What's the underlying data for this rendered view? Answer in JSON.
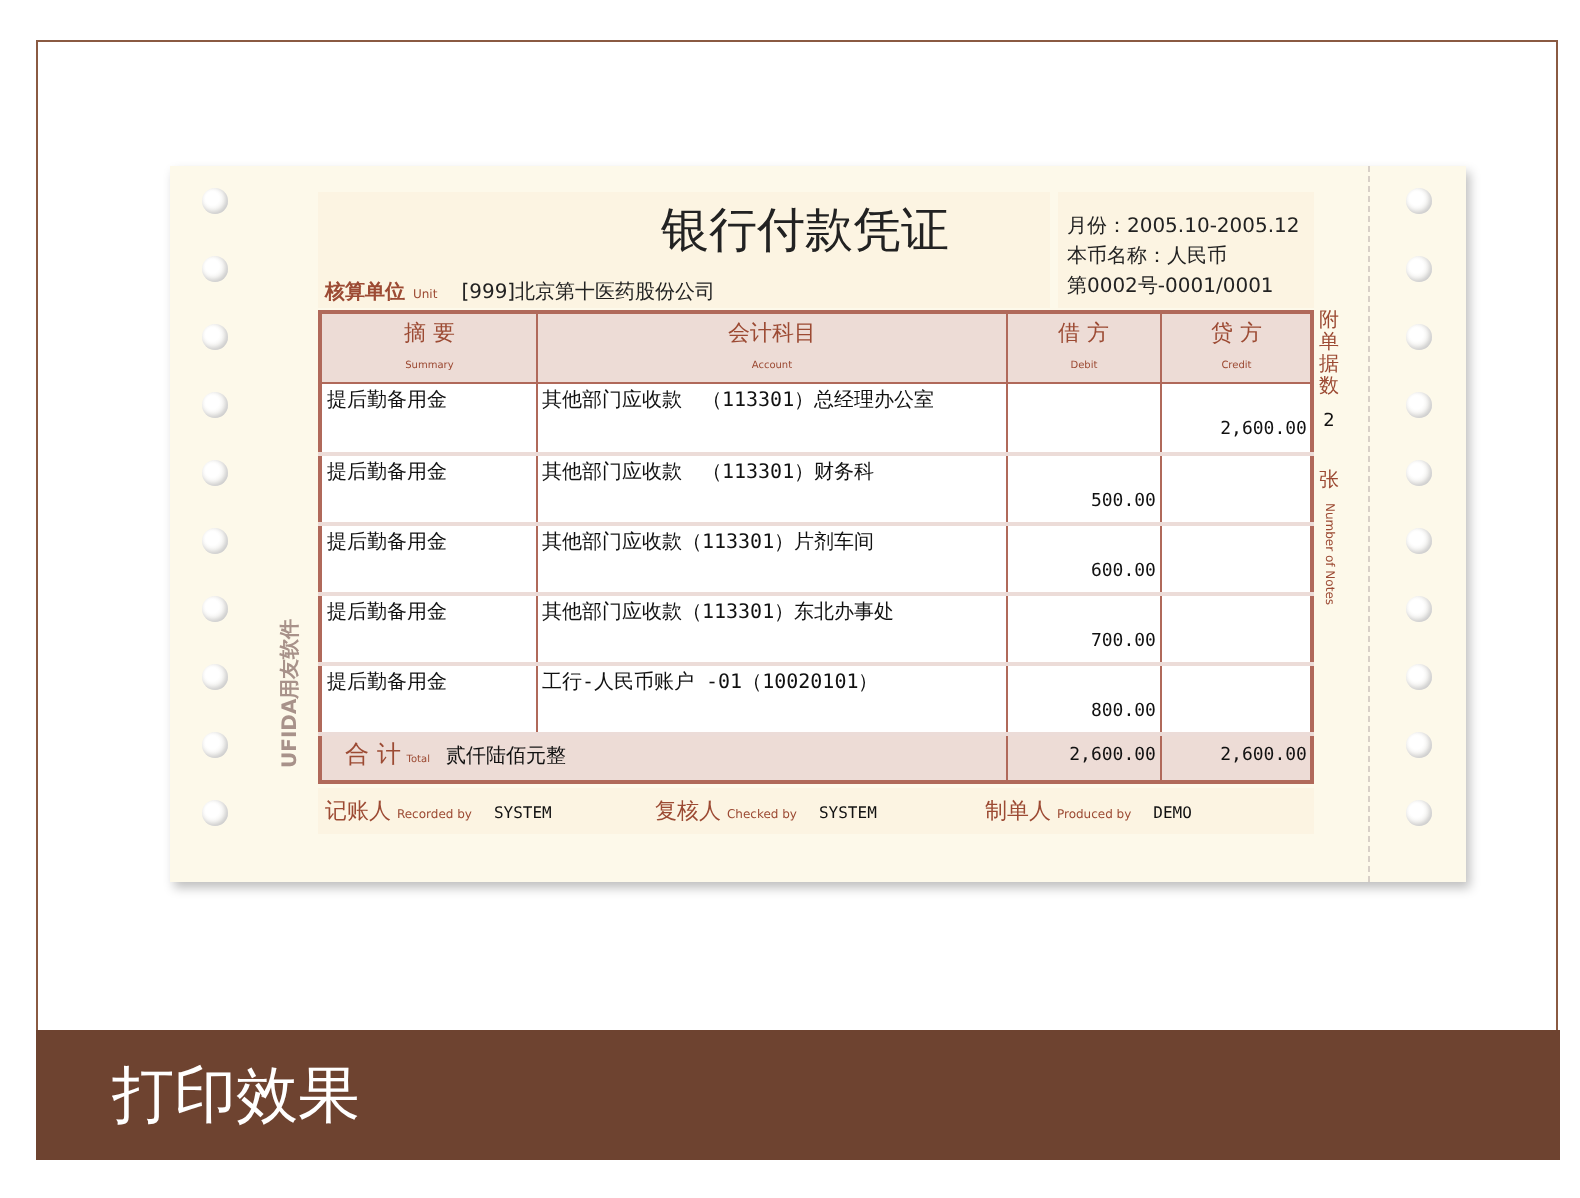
{
  "title": "银行付款凭证",
  "side_info": [
    "月份：2005.10-2005.12",
    "本币名称：人民币",
    "第0002号-0001/0001"
  ],
  "unit": {
    "label": "核算单位",
    "label_en": "Unit",
    "value": "[999]北京第十医药股份公司"
  },
  "columns": [
    {
      "label": "摘 要",
      "label_en": "Summary"
    },
    {
      "label": "会计科目",
      "label_en": "Account"
    },
    {
      "label": "借 方",
      "label_en": "Debit"
    },
    {
      "label": "贷 方",
      "label_en": "Credit"
    }
  ],
  "rows": [
    {
      "summary": "提后勤备用金",
      "account": "其他部门应收款　（113301）总经理办公室",
      "credit": "2,600.00"
    },
    {
      "summary": "提后勤备用金",
      "account": "其他部门应收款　（113301）财务科",
      "debit": "500.00"
    },
    {
      "summary": "提后勤备用金",
      "account": "其他部门应收款（113301）片剂车间",
      "debit": "600.00"
    },
    {
      "summary": "提后勤备用金",
      "account": "其他部门应收款（113301）东北办事处",
      "debit": "700.00"
    },
    {
      "summary": "提后勤备用金",
      "account": "工行-人民币账户 -01（10020101）",
      "debit": "800.00"
    }
  ],
  "total": {
    "label": "合 计",
    "label_en": "Total",
    "amount_words": "贰仟陆佰元整",
    "debit": "2,600.00",
    "credit": "2,600.00"
  },
  "attachments": {
    "label": "附单据数",
    "count": "2",
    "unit": "张",
    "unit_en": "Number of Notes"
  },
  "signatures": [
    {
      "label": "记账人",
      "label_en": "Recorded by",
      "name": "SYSTEM"
    },
    {
      "label": "复核人",
      "label_en": "Checked by",
      "name": "SYSTEM"
    },
    {
      "label": "制单人",
      "label_en": "Produced by",
      "name": "DEMO"
    }
  ],
  "margin_text": "UFIDA用友软件",
  "caption": "打印效果"
}
